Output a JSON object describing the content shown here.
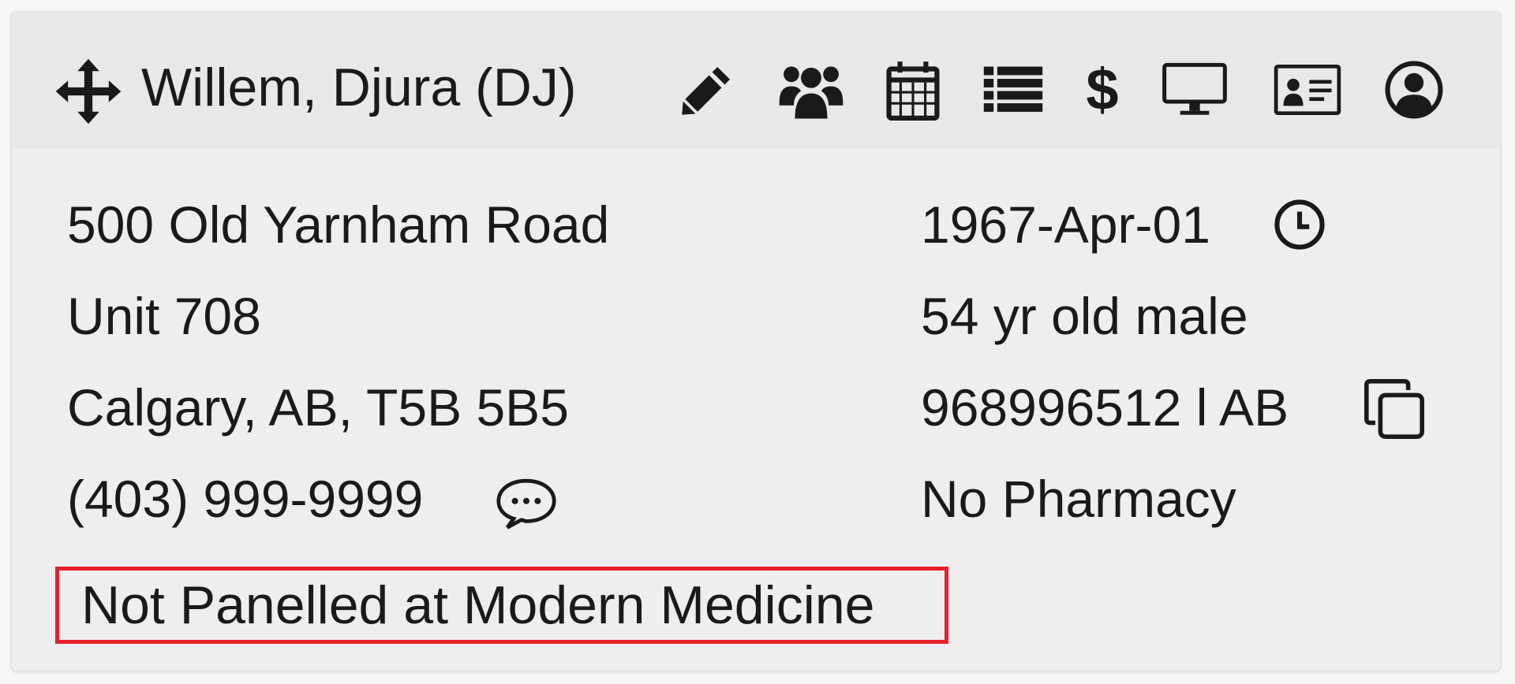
{
  "header": {
    "patient_name": "Willem, Djura (DJ)",
    "icons": [
      "move-icon",
      "pencil-icon",
      "users-icon",
      "calendar-icon",
      "list-icon",
      "dollar-icon",
      "monitor-icon",
      "id-card-icon",
      "user-circle-icon"
    ],
    "dollar_symbol": "$"
  },
  "address": {
    "line1": "500 Old Yarnham Road",
    "line2": "Unit 708",
    "city_line": "Calgary, AB, T5B 5B5",
    "phone": "(403) 999-9999"
  },
  "details": {
    "dob": "1967-Apr-01",
    "age_sex": "54 yr old male",
    "health_number": "968996512 l AB",
    "pharmacy": "No Pharmacy"
  },
  "panel_status": {
    "text": "Not Panelled at Modern Medicine",
    "highlight_color": "#e8202c"
  }
}
